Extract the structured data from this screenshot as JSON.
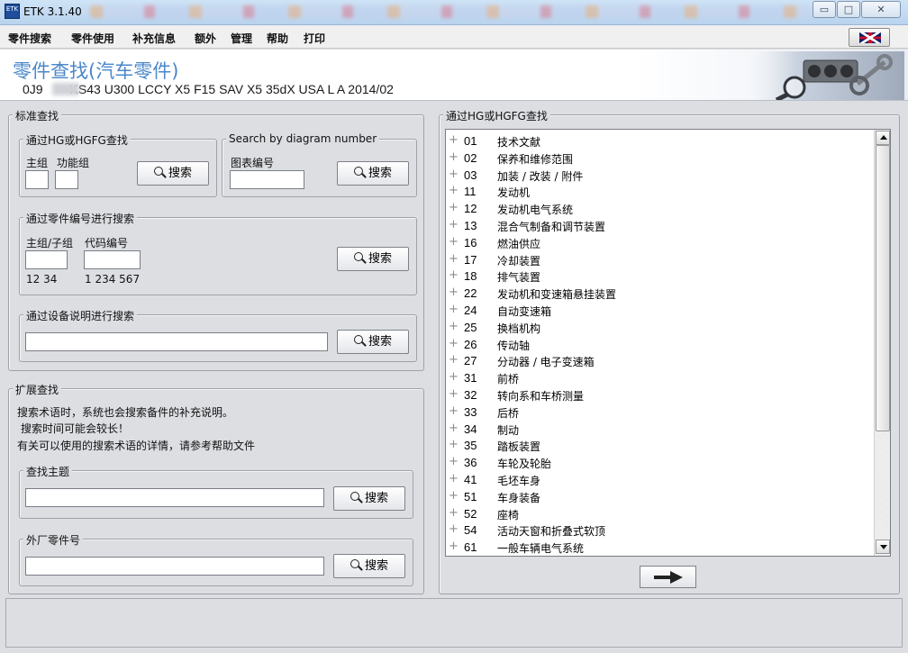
{
  "window": {
    "title": "ETK 3.1.40",
    "icon_text": "ETK",
    "min_symbol": "▭",
    "max_symbol": "□",
    "close_symbol": "✕"
  },
  "menu": [
    "零件搜索",
    "零件使用",
    "补充信息",
    "额外",
    "管理",
    "帮助",
    "打印"
  ],
  "header": {
    "title": "零件查找(汽车零件)",
    "vehicle_prefix": "0J9",
    "vehicle": "KS43 U300 LCCY X5 F15 SAV X5 35dX USA L A 2014/02"
  },
  "standard_search": {
    "legend": "标准查找",
    "hg": {
      "legend": "通过HG或HGFG查找",
      "main_group_label": "主组",
      "function_group_label": "功能组",
      "search_label": "搜索"
    },
    "diagram": {
      "legend": "Search by diagram number",
      "chart_no_label": "图表编号",
      "search_label": "搜索"
    },
    "part_number": {
      "legend": "通过零件编号进行搜索",
      "group_label": "主组/子组",
      "code_label": "代码编号",
      "group_example": "12 34",
      "code_example": "1 234 567",
      "search_label": "搜索"
    },
    "equipment": {
      "legend": "通过设备说明进行搜索",
      "search_label": "搜索"
    }
  },
  "extended_search": {
    "legend": "扩展查找",
    "note_line1": "搜索术语时，系统也会搜索备件的补充说明。",
    "note_line2": "搜索时间可能会较长！",
    "note_line3": "有关可以使用的搜索术语的详情，请参考帮助文件",
    "topic": {
      "legend": "查找主题",
      "search_label": "搜索"
    },
    "external": {
      "legend": "外厂零件号",
      "search_label": "搜索"
    }
  },
  "tree": {
    "legend": "通过HG或HGFG查找",
    "expander": "+",
    "items": [
      {
        "code": "01",
        "name": "技术文献"
      },
      {
        "code": "02",
        "name": "保养和维修范围"
      },
      {
        "code": "03",
        "name": "加装 / 改装 / 附件"
      },
      {
        "code": "11",
        "name": "发动机"
      },
      {
        "code": "12",
        "name": "发动机电气系统"
      },
      {
        "code": "13",
        "name": "混合气制备和调节装置"
      },
      {
        "code": "16",
        "name": "燃油供应"
      },
      {
        "code": "17",
        "name": "冷却装置"
      },
      {
        "code": "18",
        "name": "排气装置"
      },
      {
        "code": "22",
        "name": "发动机和变速箱悬挂装置"
      },
      {
        "code": "24",
        "name": "自动变速箱"
      },
      {
        "code": "25",
        "name": "换档机构"
      },
      {
        "code": "26",
        "name": "传动轴"
      },
      {
        "code": "27",
        "name": "分动器 / 电子变速箱"
      },
      {
        "code": "31",
        "name": "前桥"
      },
      {
        "code": "32",
        "name": "转向系和车桥测量"
      },
      {
        "code": "33",
        "name": "后桥"
      },
      {
        "code": "34",
        "name": "制动"
      },
      {
        "code": "35",
        "name": "踏板装置"
      },
      {
        "code": "36",
        "name": "车轮及轮胎"
      },
      {
        "code": "41",
        "name": "毛坯车身"
      },
      {
        "code": "51",
        "name": "车身装备"
      },
      {
        "code": "52",
        "name": "座椅"
      },
      {
        "code": "54",
        "name": "活动天窗和折叠式软顶"
      },
      {
        "code": "61",
        "name": "一般车辆电气系统"
      }
    ]
  },
  "icons": {
    "search": "magnifier-icon",
    "next": "arrow-right-icon",
    "language": "uk-flag-icon",
    "header_art": "engine-parts-magnifier-icon"
  }
}
